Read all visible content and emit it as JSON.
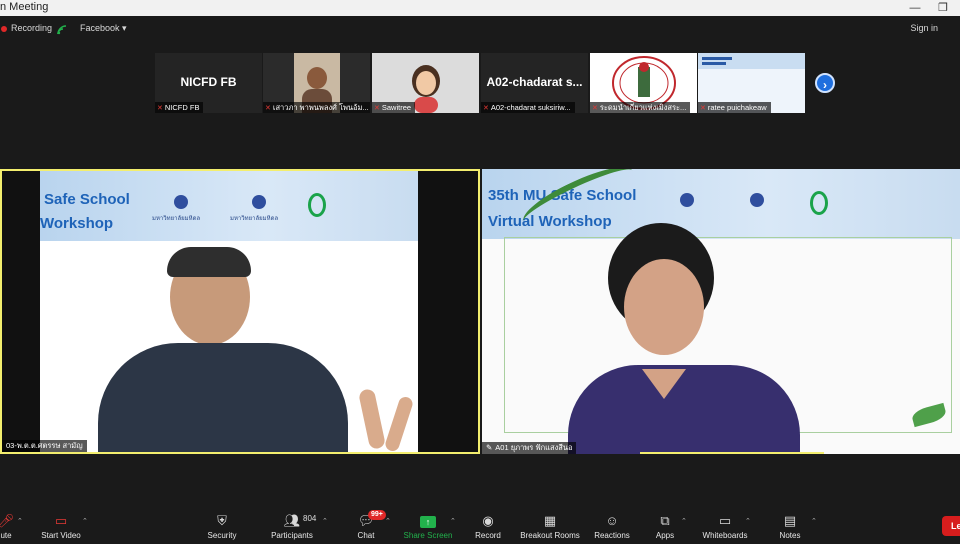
{
  "window": {
    "title": "n Meeting",
    "restore_glyph": "❐",
    "minimize_glyph": "—"
  },
  "topbar": {
    "recording": "Recording",
    "facebook": "Facebook ▾",
    "signin": "Sign in"
  },
  "thumbnails": [
    {
      "center": "NICFD FB",
      "label": "NICFD FB"
    },
    {
      "center": "",
      "label": "เสาวภา พาพนพลงศ์ โพนอ้ม..."
    },
    {
      "center": "",
      "label": "Sawitree"
    },
    {
      "center": "A02-chadarat s...",
      "label": "A02-chadarat suksiriw..."
    },
    {
      "center": "",
      "label": "ระดมนำเกี่ยวแห่งเมิงสระ..."
    },
    {
      "center": "",
      "label": "ratee puichakeaw"
    }
  ],
  "next_glyph": "›",
  "main_left": {
    "slide_title_1": "Safe School",
    "slide_title_2": "Workshop",
    "name_label": "03-พ.ต.ต.ศตรรษ สามัญ"
  },
  "main_right": {
    "slide_title_1": "35th MU Safe School",
    "slide_title_2": "Virtual Workshop",
    "name_label": "A01 ยุภาพร ฟักแสงสีนอ"
  },
  "slide_small": {
    "uni_1": "มหาวิทยาลัยมหิดล",
    "uni_2": "มหาวิทยาลัยมหิดล"
  },
  "toolbar": {
    "mute": "ute",
    "start_video": "Start Video",
    "security": "Security",
    "participants": "Participants",
    "participants_count": "804",
    "chat": "Chat",
    "chat_badge": "99+",
    "share_screen": "Share Screen",
    "record": "Record",
    "breakout": "Breakout Rooms",
    "reactions": "Reactions",
    "apps": "Apps",
    "whiteboards": "Whiteboards",
    "notes": "Notes",
    "leave": "Le"
  },
  "colors": {
    "accent": "#1f6fde",
    "active_speaker": "#f3ee6e",
    "leave": "#d71d1d",
    "share_green": "#22b14c"
  }
}
